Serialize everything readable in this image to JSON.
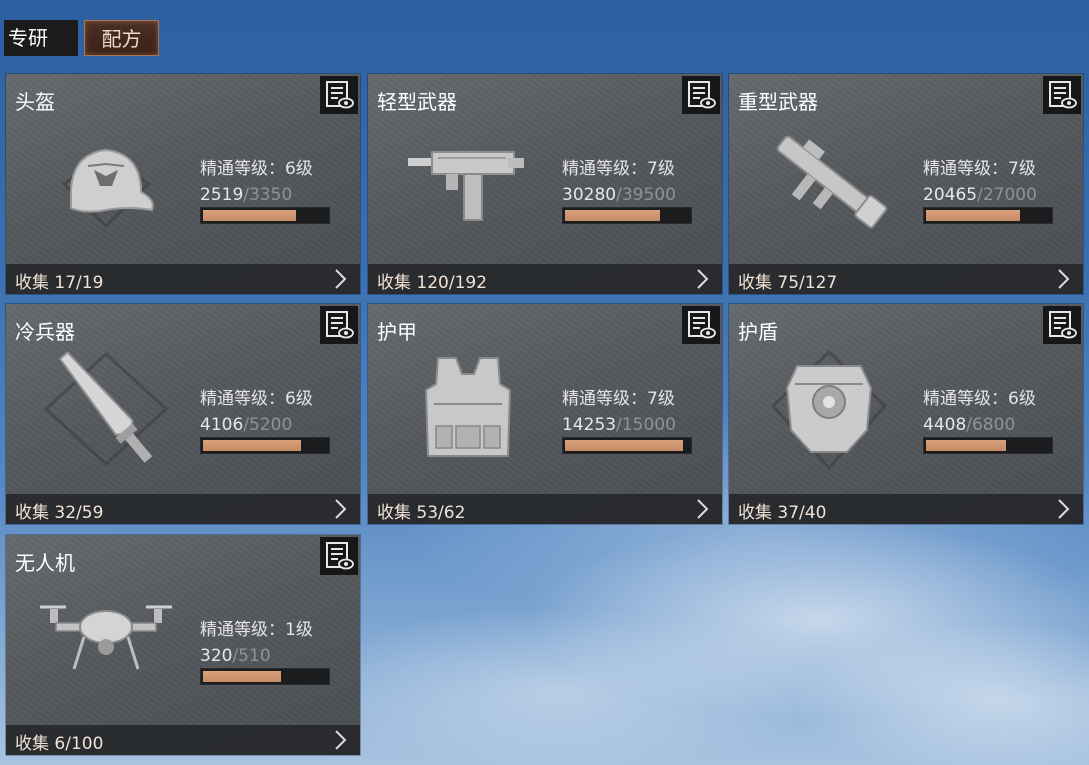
{
  "tabs": {
    "research_label": "专研",
    "recipe_label": "配方",
    "active": "配方"
  },
  "mastery_prefix": "精通等级：",
  "collect_prefix": "收集 ",
  "accent": "#c58b65",
  "cards": [
    {
      "title": "头盔",
      "mastery": "精通等级：6级",
      "current": "2519",
      "max": "/3350",
      "progress": 0.752,
      "collect": "收集 17/19",
      "icon": "helmet-cap-icon"
    },
    {
      "title": "轻型武器",
      "mastery": "精通等级：7级",
      "current": "30280",
      "max": "/39500",
      "progress": 0.767,
      "collect": "收集 120/192",
      "icon": "smg-icon"
    },
    {
      "title": "重型武器",
      "mastery": "精通等级：7级",
      "current": "20465",
      "max": "/27000",
      "progress": 0.758,
      "collect": "收集 75/127",
      "icon": "rocket-launcher-icon"
    },
    {
      "title": "冷兵器",
      "mastery": "精通等级：6级",
      "current": "4106",
      "max": "/5200",
      "progress": 0.79,
      "collect": "收集 32/59",
      "icon": "blade-icon"
    },
    {
      "title": "护甲",
      "mastery": "精通等级：7级",
      "current": "14253",
      "max": "/15000",
      "progress": 0.95,
      "collect": "收集 53/62",
      "icon": "armor-vest-icon"
    },
    {
      "title": "护盾",
      "mastery": "精通等级：6级",
      "current": "4408",
      "max": "/6800",
      "progress": 0.648,
      "collect": "收集 37/40",
      "icon": "shield-armor-icon"
    },
    {
      "title": "无人机",
      "mastery": "精通等级：1级",
      "current": "320",
      "max": "/510",
      "progress": 0.627,
      "collect": "收集 6/100",
      "icon": "drone-icon"
    }
  ]
}
